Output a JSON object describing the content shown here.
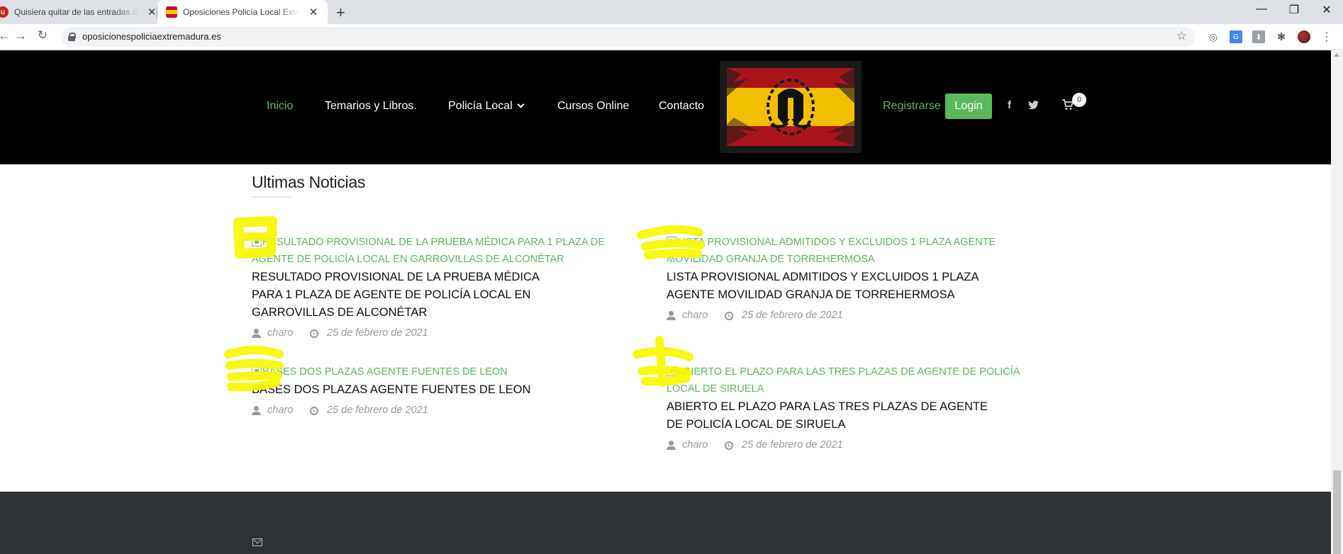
{
  "browser": {
    "tabs": [
      {
        "title": "Quisiera quitar de las entradas de",
        "favicon": "u"
      },
      {
        "title": "Oposiciones Policía Local Extremadura",
        "favicon": "site-flag"
      }
    ],
    "url": "oposicionespoliciaextremadura.es"
  },
  "header": {
    "nav": [
      "Inicio",
      "Temarios y Libros.",
      "Policía Local",
      "Cursos Online",
      "Contacto"
    ],
    "register": "Registrarse",
    "login": "Login",
    "cart_count": "0"
  },
  "section_title": "Ultimas Noticias",
  "posts": [
    {
      "image_alt": "RESULTADO PROVISIONAL DE LA PRUEBA MÉDICA PARA 1 PLAZA DE AGENTE DE POLICÍA LOCAL EN GARROVILLAS DE ALCONÉTAR",
      "title_lines": [
        "RESULTADO PROVISIONAL DE LA PRUEBA MÉDICA",
        "PARA 1 PLAZA DE AGENTE DE POLICÍA LOCAL EN",
        "GARROVILLAS DE ALCONÉTAR"
      ],
      "author": "charo",
      "date": "25 de febrero de 2021"
    },
    {
      "image_alt": "LISTA PROVISIONAL ADMITIDOS Y EXCLUIDOS 1 PLAZA AGENTE MOVILIDAD GRANJA DE TORREHERMOSA",
      "title_lines": [
        "LISTA PROVISIONAL ADMITIDOS Y EXCLUIDOS 1 PLAZA",
        "AGENTE MOVILIDAD GRANJA DE TORREHERMOSA"
      ],
      "author": "charo",
      "date": "25 de febrero de 2021"
    },
    {
      "image_alt": "BASES DOS PLAZAS AGENTE FUENTES DE LEON",
      "title_lines": [
        "BASES DOS PLAZAS AGENTE FUENTES DE LEON"
      ],
      "author": "charo",
      "date": "25 de febrero de 2021"
    },
    {
      "image_alt": "ABIERTO EL PLAZO PARA LAS TRES PLAZAS DE AGENTE DE POLICÍA LOCAL DE SIRUELA",
      "title_lines": [
        "ABIERTO EL PLAZO PARA LAS TRES PLAZAS DE AGENTE",
        "DE POLICÍA LOCAL DE SIRUELA"
      ],
      "author": "charo",
      "date": "25 de febrero de 2021"
    }
  ],
  "colors": {
    "accent_green": "#5cb85c",
    "header_bg": "#000000",
    "footer_bg": "#2f3234",
    "highlight_yellow": "#f7f700"
  }
}
